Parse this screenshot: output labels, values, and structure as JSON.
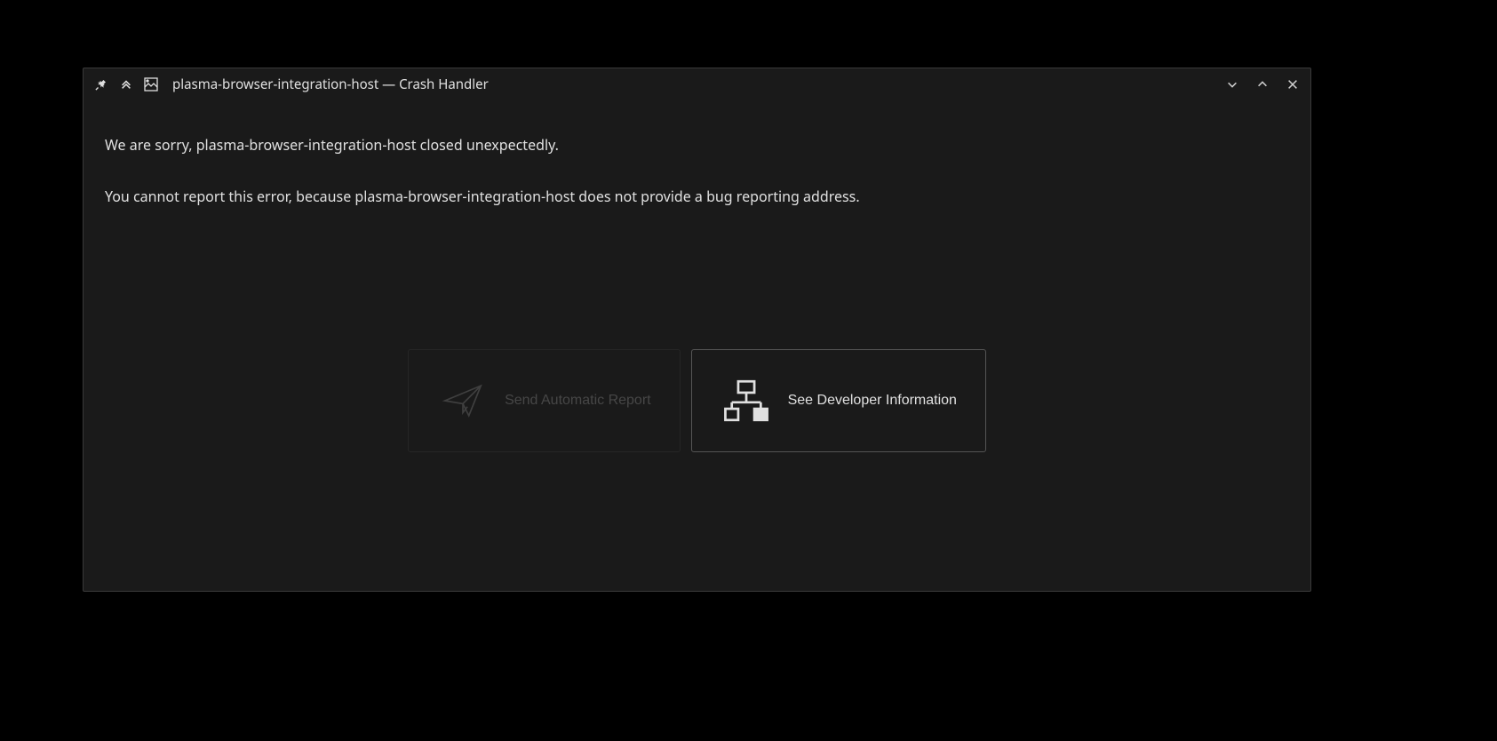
{
  "titlebar": {
    "title": "plasma-browser-integration-host — Crash Handler"
  },
  "content": {
    "message_line1": "We are sorry, plasma-browser-integration-host closed unexpectedly.",
    "message_line2": "You cannot report this error, because plasma-browser-integration-host does not provide a bug reporting address."
  },
  "buttons": {
    "send_report": "Send Automatic Report",
    "developer_info": "See Developer Information"
  }
}
